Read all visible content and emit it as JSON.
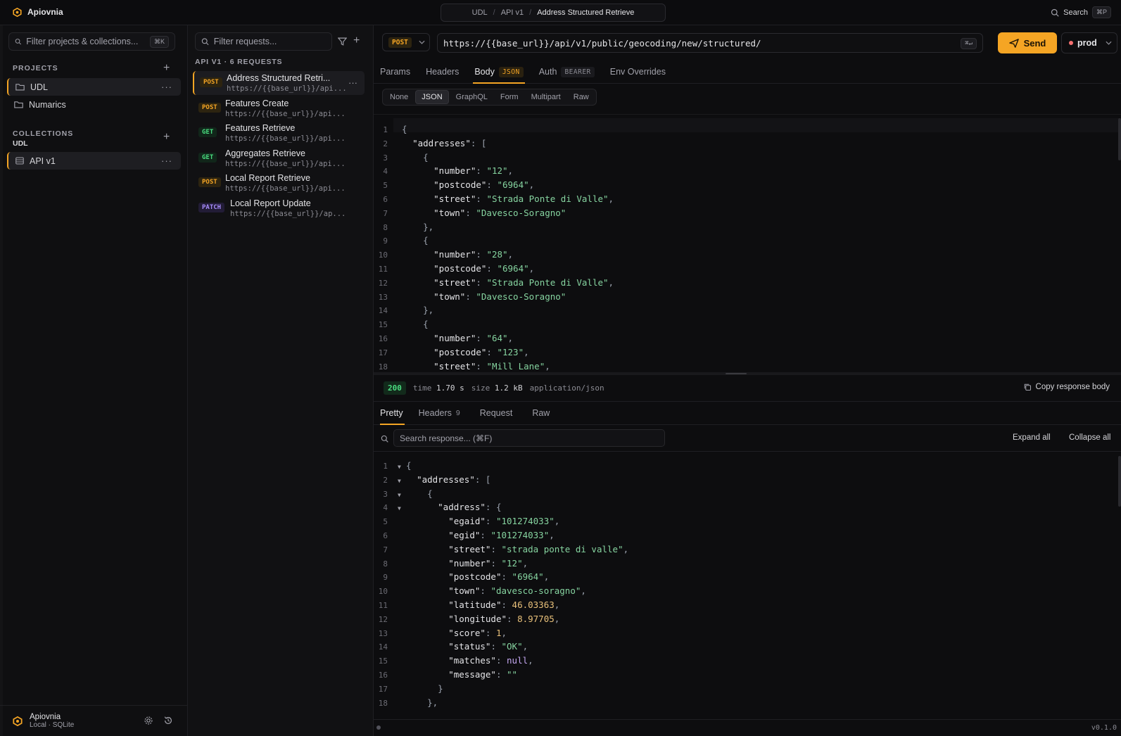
{
  "app": {
    "name": "Apiovnia",
    "version": "v0.1.0"
  },
  "breadcrumb": [
    "UDL",
    "API v1",
    "Address Structured Retrieve"
  ],
  "top_search": {
    "label": "Search",
    "shortcut": "⌘P"
  },
  "sidebar": {
    "filter_placeholder": "Filter projects & collections...",
    "filter_shortcut": "⌘K",
    "projects_title": "PROJECTS",
    "projects": [
      {
        "label": "UDL",
        "active": true
      },
      {
        "label": "Numarics",
        "active": false
      }
    ],
    "collections_title": "COLLECTIONS",
    "collections_project": "UDL",
    "collections": [
      {
        "label": "API v1",
        "active": true
      }
    ],
    "footer": {
      "title": "Apiovnia",
      "subtitle": "Local · SQLite"
    }
  },
  "requests": {
    "filter_placeholder": "Filter requests...",
    "header": "API V1 · 6 REQUESTS",
    "items": [
      {
        "method": "POST",
        "name": "Address Structured Retri...",
        "url": "https://{{base_url}}/api...",
        "active": true
      },
      {
        "method": "POST",
        "name": "Features Create",
        "url": "https://{{base_url}}/api...",
        "active": false
      },
      {
        "method": "GET",
        "name": "Features Retrieve",
        "url": "https://{{base_url}}/api...",
        "active": false
      },
      {
        "method": "GET",
        "name": "Aggregates Retrieve",
        "url": "https://{{base_url}}/api...",
        "active": false
      },
      {
        "method": "POST",
        "name": "Local Report Retrieve",
        "url": "https://{{base_url}}/api...",
        "active": false
      },
      {
        "method": "PATCH",
        "name": "Local Report Update",
        "url": "https://{{base_url}}/ap...",
        "active": false
      }
    ]
  },
  "request": {
    "method": "POST",
    "url": "https://{{base_url}}/api/v1/public/geocoding/new/structured/",
    "url_shortcut": "⌘↵",
    "send_label": "Send",
    "environment": "prod",
    "tabs": [
      {
        "label": "Params",
        "badge": ""
      },
      {
        "label": "Headers",
        "badge": ""
      },
      {
        "label": "Body",
        "badge": "JSON",
        "active": true
      },
      {
        "label": "Auth",
        "badge": "BEARER"
      },
      {
        "label": "Env Overrides",
        "badge": ""
      }
    ],
    "body_types": [
      "None",
      "JSON",
      "GraphQL",
      "Form",
      "Multipart",
      "Raw"
    ],
    "body_type_active": "JSON",
    "body_lines": [
      "{",
      "  \"addresses\": [",
      "    {",
      "      \"number\": \"12\",",
      "      \"postcode\": \"6964\",",
      "      \"street\": \"Strada Ponte di Valle\",",
      "      \"town\": \"Davesco-Soragno\"",
      "    },",
      "    {",
      "      \"number\": \"28\",",
      "      \"postcode\": \"6964\",",
      "      \"street\": \"Strada Ponte di Valle\",",
      "      \"town\": \"Davesco-Soragno\"",
      "    },",
      "    {",
      "      \"number\": \"64\",",
      "      \"postcode\": \"123\",",
      "      \"street\": \"Mill Lane\","
    ]
  },
  "response": {
    "status": "200",
    "time_label": "time",
    "time": "1.70 s",
    "size_label": "size",
    "size": "1.2 kB",
    "content_type": "application/json",
    "copy_label": "Copy response body",
    "tabs": [
      {
        "label": "Pretty",
        "count": "",
        "active": true
      },
      {
        "label": "Headers",
        "count": "9"
      },
      {
        "label": "Request",
        "count": ""
      },
      {
        "label": "Raw",
        "count": ""
      }
    ],
    "search_placeholder": "Search response... (⌘F)",
    "expand_all": "Expand all",
    "collapse_all": "Collapse all",
    "lines": [
      "{",
      "  \"addresses\": [",
      "    {",
      "      \"address\": {",
      "        \"egaid\": \"101274033\",",
      "        \"egid\": \"101274033\",",
      "        \"street\": \"strada ponte di valle\",",
      "        \"number\": \"12\",",
      "        \"postcode\": \"6964\",",
      "        \"town\": \"davesco-soragno\",",
      "        \"latitude\": 46.03363,",
      "        \"longitude\": 8.97705,",
      "        \"score\": 1,",
      "        \"status\": \"OK\",",
      "        \"matches\": null,",
      "        \"message\": \"\"",
      "      }",
      "    },"
    ]
  },
  "colors": {
    "accent": "#f5a524",
    "post": "#f5a524",
    "get": "#4ade80",
    "patch": "#a78bfa",
    "success": "#4ade80"
  }
}
